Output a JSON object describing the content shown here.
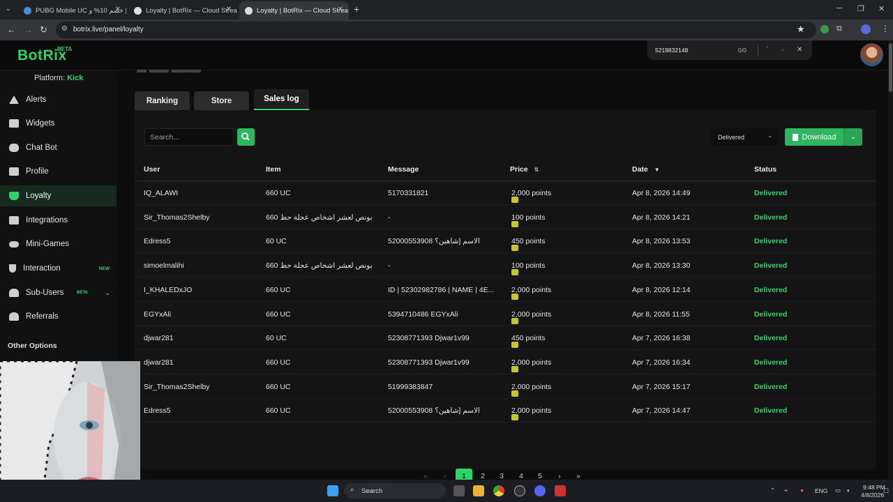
{
  "browser": {
    "tabs": [
      {
        "label": "PUBG Mobile UC خصم 10% و |",
        "active": false
      },
      {
        "label": "Loyalty | BotRix — Cloud Strea",
        "active": false
      },
      {
        "label": "Loyalty | BotRix — Cloud Strea",
        "active": true
      }
    ],
    "new_tab": "+",
    "url": "botrix.live/panel/loyalty"
  },
  "find_bar": {
    "query": "5219832148",
    "count": "0/0"
  },
  "brand": {
    "logo": "BotRix",
    "badge": "BETA",
    "accent": "#2fd36b"
  },
  "sidebar": {
    "platform_label": "Platform:",
    "platform_value": "Kick",
    "items": [
      {
        "label": "Alerts",
        "icon": "warning-icon"
      },
      {
        "label": "Widgets",
        "icon": "grid-icon"
      },
      {
        "label": "Chat Bot",
        "icon": "robot-icon"
      },
      {
        "label": "Profile",
        "icon": "id-card-icon"
      },
      {
        "label": "Loyalty",
        "icon": "trophy-icon",
        "active": true
      },
      {
        "label": "Integrations",
        "icon": "integration-icon"
      },
      {
        "label": "Mini-Games",
        "icon": "gamepad-icon"
      },
      {
        "label": "Interaction",
        "icon": "music-icon",
        "badge": "NEW"
      },
      {
        "label": "Sub-Users",
        "icon": "users-icon",
        "badge": "BETA"
      },
      {
        "label": "Referrals",
        "icon": "referral-icon"
      }
    ],
    "other_options": "Other Options"
  },
  "tabs": [
    {
      "label": "Ranking",
      "active": false
    },
    {
      "label": "Store",
      "active": false
    },
    {
      "label": "Sales log",
      "active": true
    }
  ],
  "toolbar": {
    "search_placeholder": "Search...",
    "status_filter": "Delivered",
    "download_label": "Download"
  },
  "table": {
    "columns": [
      "User",
      "Item",
      "Message",
      "Price",
      "Date",
      "Status"
    ],
    "rows": [
      {
        "user": "IQ_ALAWI",
        "item": "660 UC",
        "message": "5170331821",
        "price": "2,000 points",
        "date": "Apr 8, 2026 14:49",
        "status": "Delivered"
      },
      {
        "user": "Sir_Thomas2Shelby",
        "item": "660 بونص لعشر اشخاص عجلة حظ",
        "message": "-",
        "price": "100 points",
        "date": "Apr 8, 2026 14:21",
        "status": "Delivered"
      },
      {
        "user": "Edress5",
        "item": "60 UC",
        "message": "52000553908 الاسم [شاهين؟",
        "price": "450 points",
        "date": "Apr 8, 2026 13:53",
        "status": "Delivered"
      },
      {
        "user": "simoelmalihi",
        "item": "660 بونص لعشر اشخاص عجلة حظ",
        "message": "-",
        "price": "100 points",
        "date": "Apr 8, 2026 13:30",
        "status": "Delivered"
      },
      {
        "user": "I_KHALEDxJO",
        "item": "660 UC",
        "message": "ID | 52302982786 | NAME | 4E...",
        "price": "2,000 points",
        "date": "Apr 8, 2026 12:14",
        "status": "Delivered"
      },
      {
        "user": "EGYxAli",
        "item": "660 UC",
        "message": "5394710486 EGYxAli",
        "price": "2,000 points",
        "date": "Apr 8, 2026 11:55",
        "status": "Delivered"
      },
      {
        "user": "djwar281",
        "item": "60 UC",
        "message": "52308771393 Djwar1v99",
        "price": "450 points",
        "date": "Apr 7, 2026 16:38",
        "status": "Delivered"
      },
      {
        "user": "djwar281",
        "item": "660 UC",
        "message": "52308771393 Djwar1v99",
        "price": "2,000 points",
        "date": "Apr 7, 2026 16:34",
        "status": "Delivered"
      },
      {
        "user": "Sir_Thomas2Shelby",
        "item": "660 UC",
        "message": "51999383847",
        "price": "2,000 points",
        "date": "Apr 7, 2026 15:17",
        "status": "Delivered"
      },
      {
        "user": "Edress5",
        "item": "660 UC",
        "message": "52000553908 الاسم [شاهين؟",
        "price": "2,000 points",
        "date": "Apr 7, 2026 14:47",
        "status": "Delivered"
      }
    ]
  },
  "pagination": {
    "first": "«",
    "prev": "‹",
    "pages": [
      "1",
      "2",
      "3",
      "4",
      "5"
    ],
    "next": "›",
    "last": "»",
    "current": "1"
  },
  "taskbar": {
    "search": "Search",
    "lang": "ENG",
    "time": "9:48 PM",
    "date": "4/8/2026"
  }
}
